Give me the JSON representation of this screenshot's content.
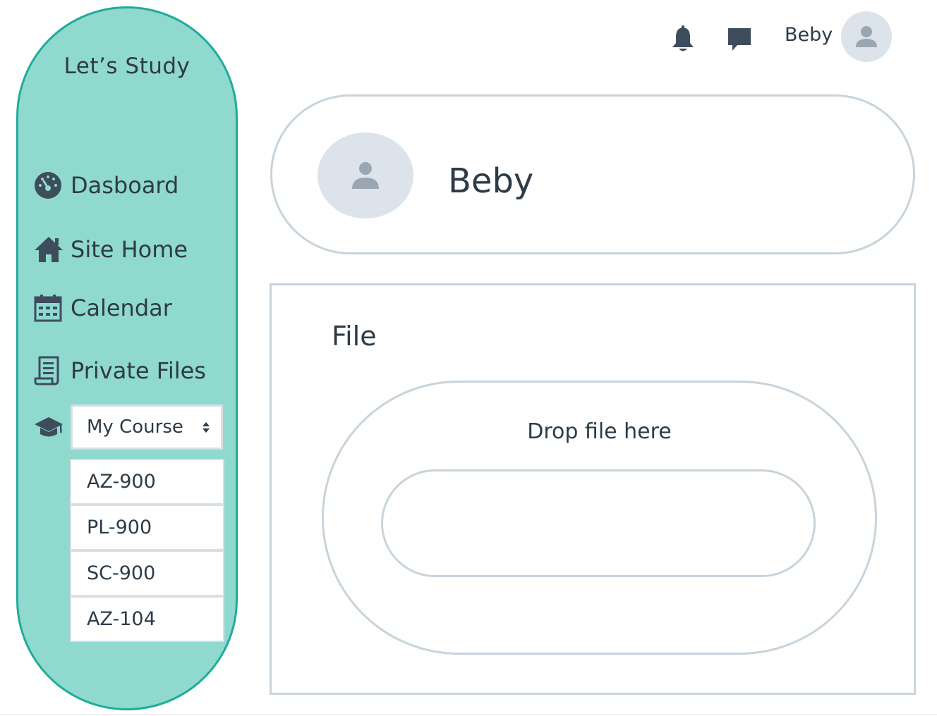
{
  "colors": {
    "sidebar_bg": "#8fd9cf",
    "sidebar_border": "#1fac9a",
    "text": "#2e3b47",
    "outline": "#c9d3dc",
    "avatar_bg": "#dde3ea"
  },
  "sidebar": {
    "brand": "Let’s Study",
    "items": [
      {
        "label": "Dasboard",
        "icon": "dashboard-gauge-icon"
      },
      {
        "label": "Site Home",
        "icon": "home-icon"
      },
      {
        "label": "Calendar",
        "icon": "calendar-icon"
      },
      {
        "label": "Private Files",
        "icon": "document-icon"
      }
    ],
    "course_select": {
      "label": "My Course",
      "icon": "graduation-cap-icon"
    },
    "courses": [
      "AZ-900",
      "PL-900",
      "SC-900",
      "AZ-104"
    ]
  },
  "topbar": {
    "user_name": "Beby",
    "icons": [
      "bell-icon",
      "chat-icon",
      "user-avatar-icon"
    ]
  },
  "profile": {
    "name": "Beby"
  },
  "file_panel": {
    "title": "File",
    "drop_text": "Drop file here"
  }
}
